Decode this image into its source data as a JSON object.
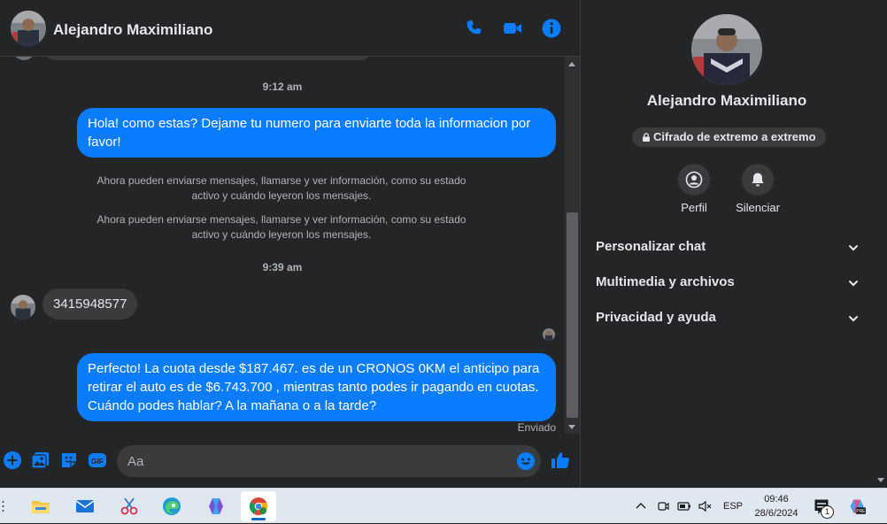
{
  "contact": {
    "name": "Alejandro Maximiliano"
  },
  "messages": {
    "time1": "9:12 am",
    "out1": "Hola! como estas? Dejame tu numero para enviarte toda la informacion por favor!",
    "sys1": "Ahora pueden enviarse mensajes, llamarse y ver información, como su estado activo y cuándo leyeron los mensajes.",
    "sys2": "Ahora pueden enviarse mensajes, llamarse y ver información, como su estado activo y cuándo leyeron los mensajes.",
    "time2": "9:39 am",
    "in1": "3415948577",
    "out2": "Perfecto! La cuota desde $187.467. es de un CRONOS 0KM el anticipo para retirar el auto es de $6.743.700 , mientras tanto podes ir pagando en cuotas. Cuándo podes hablar? A la mañana o a la tarde?",
    "status": "Enviado"
  },
  "composer": {
    "placeholder": "Aa"
  },
  "info": {
    "name": "Alejandro Maximiliano",
    "encryption": "Cifrado de extremo a extremo",
    "actions": {
      "profile": "Perfil",
      "mute": "Silenciar"
    },
    "sections": [
      "Personalizar chat",
      "Multimedia y archivos",
      "Privacidad y ayuda"
    ]
  },
  "taskbar": {
    "language": "ESP",
    "time": "09:46",
    "date": "28/6/2024",
    "notifications": "1"
  },
  "colors": {
    "accent": "#0a7cff",
    "background": "#242526",
    "bubble_in": "#3a3b3c"
  }
}
